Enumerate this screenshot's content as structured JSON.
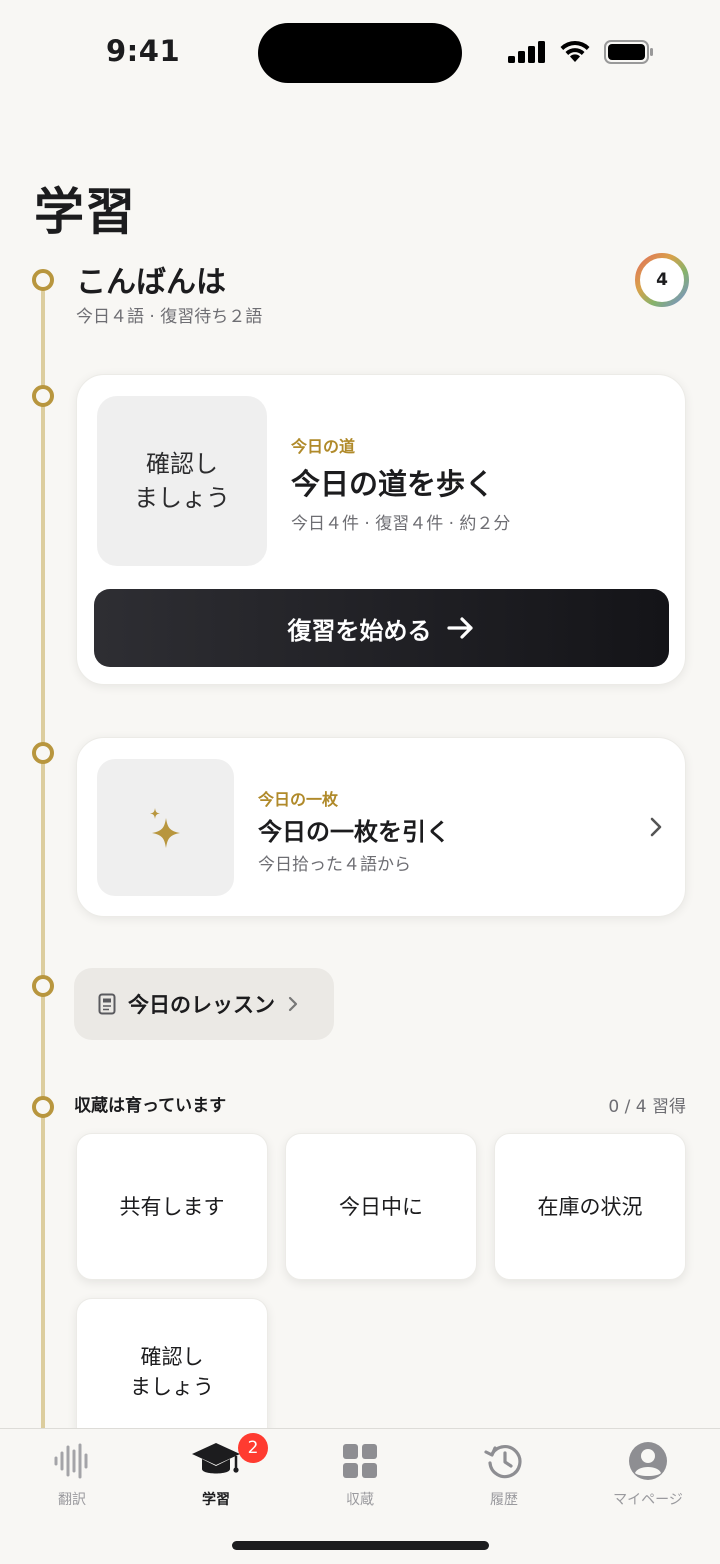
{
  "status": {
    "time": "9:41"
  },
  "page": {
    "title": "学習"
  },
  "greeting": {
    "title": "こんばんは",
    "subtitle": "今日４語 · 復習待ち２語",
    "ring_count": "4"
  },
  "path_card": {
    "thumb_text": "確認し\nましょう",
    "eyebrow": "今日の道",
    "title": "今日の道を歩く",
    "subtitle": "今日４件 · 復習４件 · 約２分",
    "cta_label": "復習を始める",
    "cta_icon": "arrow-right-icon"
  },
  "card_draw": {
    "eyebrow": "今日の一枚",
    "title": "今日の一枚を引く",
    "subtitle": "今日拾った４語から",
    "icon": "sparkle-icon"
  },
  "lesson": {
    "label": "今日のレッスン",
    "icon": "book-icon"
  },
  "collection": {
    "label": "収蔵は育っています",
    "count": "0 / 4 習得",
    "items": [
      "共有します",
      "今日中に",
      "在庫の状況",
      "確認し\nましょう"
    ]
  },
  "tabbar": {
    "items": [
      {
        "label": "翻訳",
        "icon": "waveform-icon"
      },
      {
        "label": "学習",
        "icon": "graduation-cap-icon"
      },
      {
        "label": "収蔵",
        "icon": "grid-icon"
      },
      {
        "label": "履歴",
        "icon": "history-icon"
      },
      {
        "label": "マイページ",
        "icon": "profile-icon"
      }
    ],
    "active_index": 1,
    "badge": "2"
  },
  "colors": {
    "accent": "#b8963e",
    "badge": "#ff3b30",
    "cta": "#1c1c20"
  }
}
